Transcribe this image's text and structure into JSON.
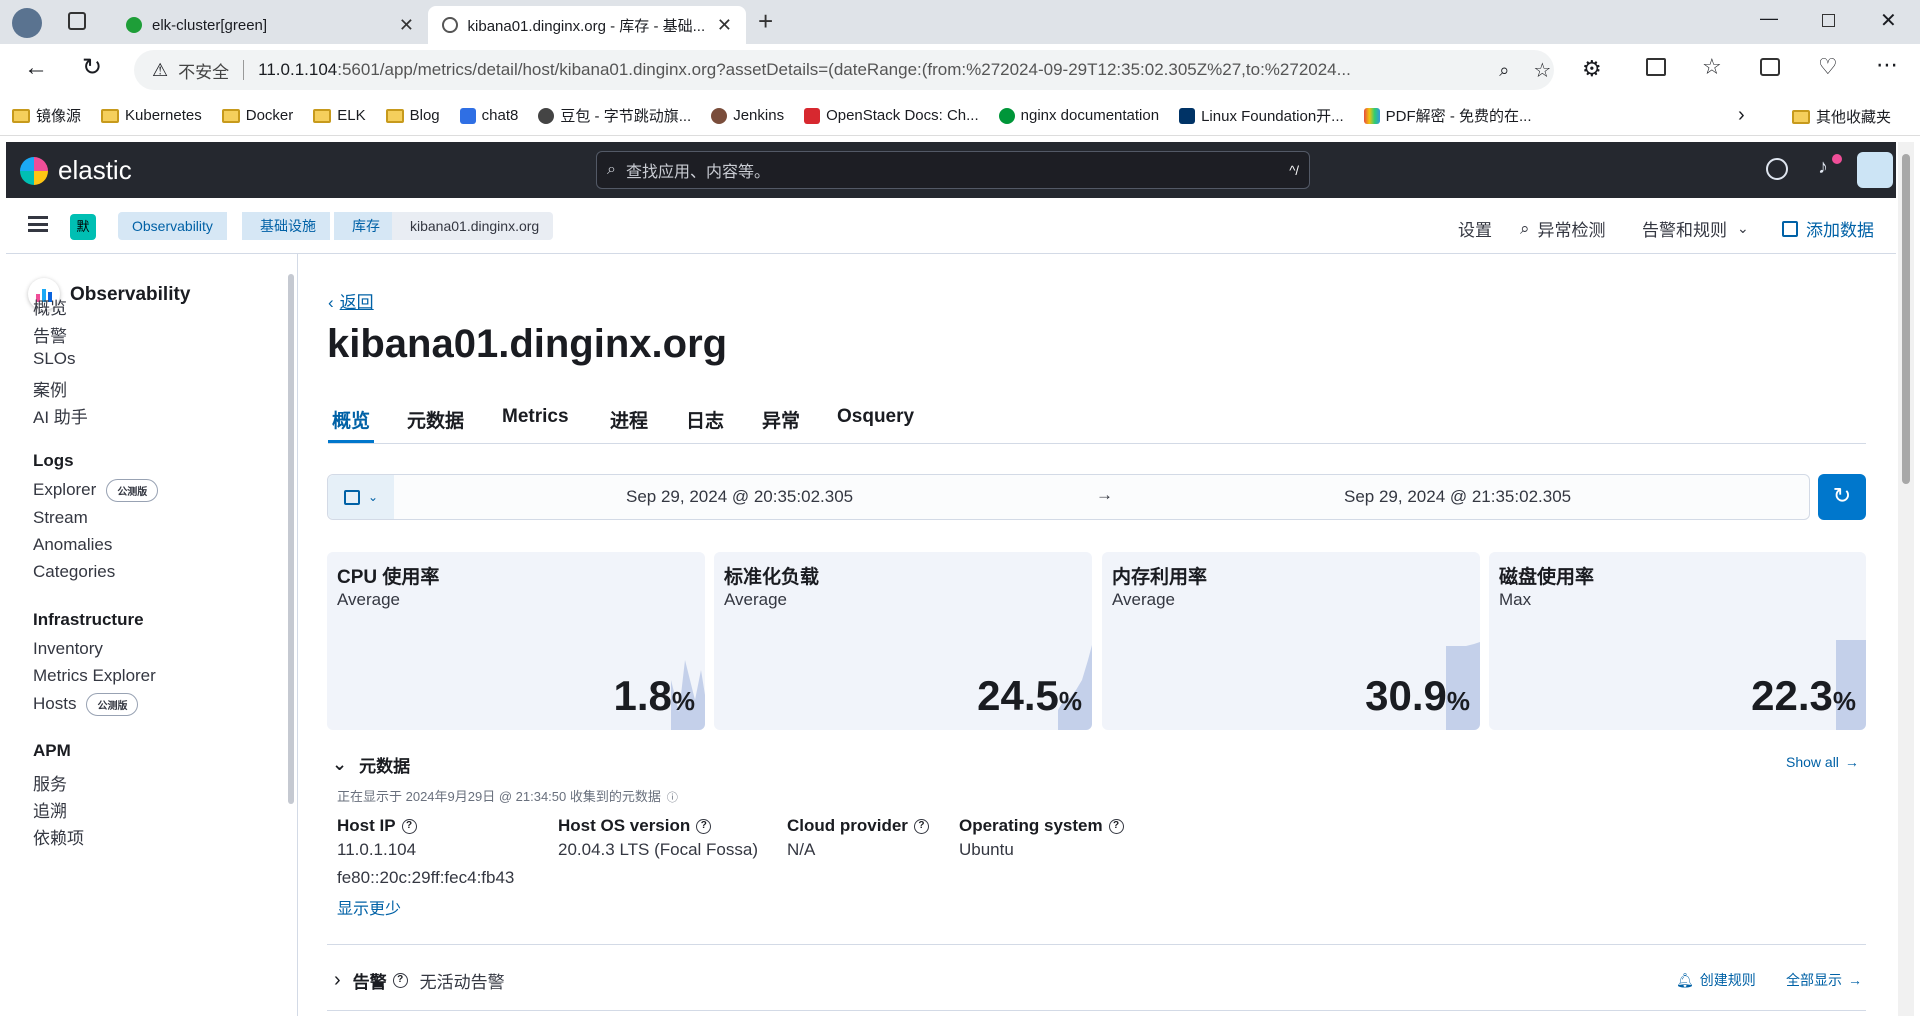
{
  "browser": {
    "tabs": [
      {
        "title": "elk-cluster[green]"
      },
      {
        "title": "kibana01.dinginx.org - 库存 - 基础..."
      }
    ],
    "address": {
      "security": "不安全",
      "host": "11.0.1.104",
      "rest": ":5601/app/metrics/detail/host/kibana01.dinginx.org?assetDetails=(dateRange:(from:%272024-09-29T12:35:02.305Z%27,to:%272024..."
    },
    "bookmarks": [
      {
        "label": "镜像源",
        "type": "folder"
      },
      {
        "label": "Kubernetes",
        "type": "folder"
      },
      {
        "label": "Docker",
        "type": "folder"
      },
      {
        "label": "ELK",
        "type": "folder"
      },
      {
        "label": "Blog",
        "type": "folder"
      },
      {
        "label": "chat8",
        "type": "site",
        "color": "#2f6fe4"
      },
      {
        "label": "豆包 - 字节跳动旗...",
        "type": "site",
        "color": "#444"
      },
      {
        "label": "Jenkins",
        "type": "site",
        "color": "#7a4d3b"
      },
      {
        "label": "OpenStack Docs: Ch...",
        "type": "site",
        "color": "#d7282f"
      },
      {
        "label": "nginx documentation",
        "type": "site",
        "color": "#009639"
      },
      {
        "label": "Linux Foundation开...",
        "type": "site",
        "color": "#003366"
      },
      {
        "label": "PDF解密 - 免费的在...",
        "type": "site",
        "color": "#e74c3c"
      }
    ],
    "other_bookmarks": "其他收藏夹"
  },
  "kibana": {
    "logo": "elastic",
    "search_placeholder": "查找应用、内容等。",
    "search_shortcut": "^/",
    "space_badge": "默",
    "breadcrumbs": [
      "Observability",
      "基础设施",
      "库存",
      "kibana01.dinginx.org"
    ],
    "header_actions": {
      "settings": "设置",
      "anomaly": "异常检测",
      "alerts": "告警和规则",
      "add_data": "添加数据"
    }
  },
  "sidenav": {
    "title": "Observability",
    "top_items": [
      "概览",
      "告警",
      "SLOs",
      "案例",
      "AI 助手"
    ],
    "logs_title": "Logs",
    "logs_items": [
      "Explorer",
      "Stream",
      "Anomalies",
      "Categories"
    ],
    "beta_label": "公测版",
    "infra_title": "Infrastructure",
    "infra_items": [
      "Inventory",
      "Metrics Explorer",
      "Hosts"
    ],
    "apm_title": "APM",
    "apm_items": [
      "服务",
      "追溯",
      "依赖项"
    ]
  },
  "main": {
    "back": "返回",
    "title": "kibana01.dinginx.org",
    "tabs": [
      "概览",
      "元数据",
      "Metrics",
      "进程",
      "日志",
      "异常",
      "Osquery"
    ],
    "active_tab": 0,
    "date_start": "Sep 29, 2024 @ 20:35:02.305",
    "date_end": "Sep 29, 2024 @ 21:35:02.305",
    "kpis": [
      {
        "title": "CPU 使用率",
        "agg": "Average",
        "value": "1.8",
        "unit": "%"
      },
      {
        "title": "标准化负载",
        "agg": "Average",
        "value": "24.5",
        "unit": "%"
      },
      {
        "title": "内存利用率",
        "agg": "Average",
        "value": "30.9",
        "unit": "%"
      },
      {
        "title": "磁盘使用率",
        "agg": "Max",
        "value": "22.3",
        "unit": "%"
      }
    ],
    "metadata": {
      "section_title": "元数据",
      "show_all": "Show all",
      "collected": "正在显示于 2024年9月29日 @ 21:34:50 收集到的元数据",
      "fields": [
        {
          "label": "Host IP",
          "values": [
            "11.0.1.104",
            "fe80::20c:29ff:fec4:fb43"
          ]
        },
        {
          "label": "Host OS version",
          "values": [
            "20.04.3 LTS (Focal Fossa)"
          ]
        },
        {
          "label": "Cloud provider",
          "values": [
            "N/A"
          ]
        },
        {
          "label": "Operating system",
          "values": [
            "Ubuntu"
          ]
        }
      ],
      "show_less": "显示更少"
    },
    "alerts": {
      "title": "告警",
      "status": "无活动告警",
      "create_rule": "创建规则",
      "show_all": "全部显示"
    }
  },
  "colors": {
    "accent": "#0077cc",
    "header_dark": "#25282f",
    "card_bg": "#f1f4fa",
    "spark": "#c4d0ea"
  }
}
